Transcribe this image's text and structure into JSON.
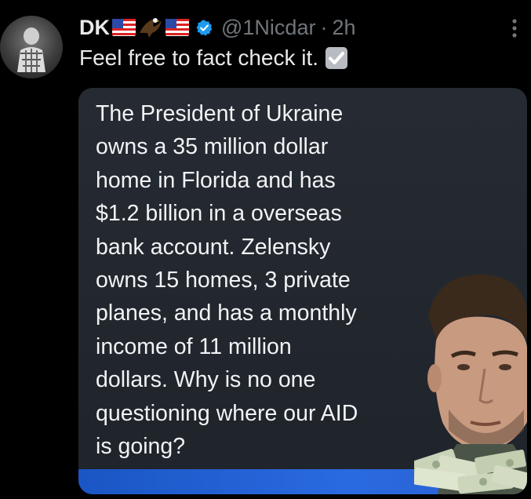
{
  "tweet": {
    "author_name": "DK",
    "handle": "@1Nicdar",
    "separator": "·",
    "time": "2h",
    "icons": [
      "flag-us-icon",
      "eagle-icon",
      "flag-us-icon",
      "verified-badge-icon",
      "more-options-icon"
    ],
    "text": "Feel free to fact check it.",
    "text_emoji": "check-mark-button-icon"
  },
  "media": {
    "meme_lines": [
      "The President of Ukraine",
      "owns a 35 million dollar",
      "home in Florida and has",
      "$1.2 billion in a overseas",
      "bank account. Zelensky",
      "owns 15 homes, 3 private",
      "planes, and has a monthly",
      "income of 11 million",
      "dollars. Why is no one",
      "questioning where our AID",
      "is going?"
    ]
  },
  "colors": {
    "background": "#000000",
    "text_primary": "#e7e9ea",
    "text_secondary": "#71767b",
    "verified_blue": "#1d9bf0",
    "meme_background": "#22272e",
    "meme_bar_blue": "#2563d6"
  }
}
